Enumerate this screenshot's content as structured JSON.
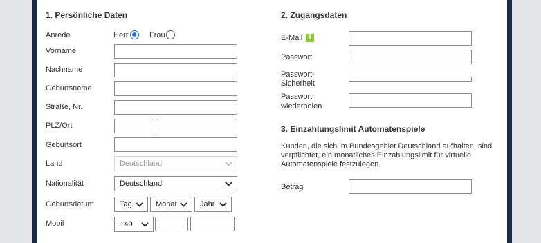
{
  "section1": {
    "title": "1. Persönliche Daten",
    "anrede_label": "Anrede",
    "herr_label": "Herr",
    "frau_label": "Frau",
    "vorname_label": "Vorname",
    "nachname_label": "Nachname",
    "geburtsname_label": "Geburtsname",
    "strasse_label": "Straße, Nr.",
    "plz_label": "PLZ/Ort",
    "geburtsort_label": "Geburtsort",
    "land_label": "Land",
    "land_value": "Deutschland",
    "nationalitaet_label": "Nationalität",
    "nationalitaet_value": "Deutschland",
    "geburtsdatum_label": "Geburtsdatum",
    "tag_value": "Tag",
    "monat_value": "Monat",
    "jahr_value": "Jahr",
    "mobil_label": "Mobil",
    "vorwahl_value": "+49"
  },
  "section2": {
    "title": "2. Zugangsdaten",
    "email_label": "E-Mail",
    "info_icon": "i",
    "passwort_label": "Passwort",
    "staerke_label_1": "Passwort-",
    "staerke_label_2": "Sicherheit",
    "wiederholen_label_1": "Passwort",
    "wiederholen_label_2": "wiederholen"
  },
  "section3": {
    "title": "3. Einzahlungslimit Automatenspiele",
    "text_line_1": "Kunden, die sich im Bundesgebiet Deutschland aufhalten, sind",
    "text_line_2": "verpflichtet, ein monatliches Einzahlungslimit für virtuelle",
    "text_line_3": "Automatenspiele festzulegen.",
    "betrag_label": "Betrag"
  },
  "colors": {
    "frame": "#1a2b4a",
    "background": "#e3e5e6",
    "radio_accent": "#1a73e8",
    "info_green": "#8dc63f"
  }
}
